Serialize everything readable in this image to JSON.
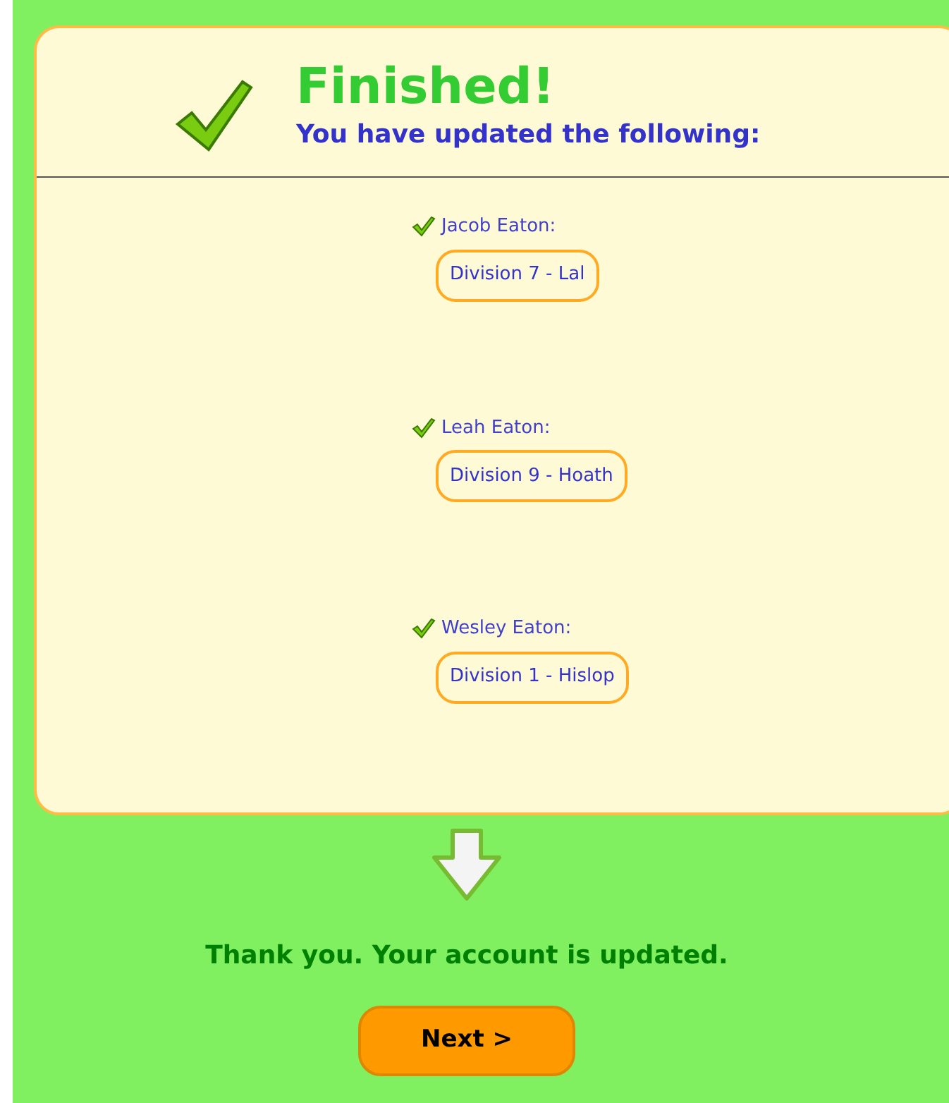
{
  "header": {
    "title": "Finished!",
    "subtitle": "You have updated the following:"
  },
  "updates": [
    {
      "name": "Jacob Eaton:",
      "value": "Division 7 - Lal"
    },
    {
      "name": "Leah Eaton:",
      "value": "Division 9 - Hoath"
    },
    {
      "name": "Wesley Eaton:",
      "value": "Division 1 - Hislop"
    }
  ],
  "message": "Thank you. Your account is updated.",
  "next_button": "Next >"
}
